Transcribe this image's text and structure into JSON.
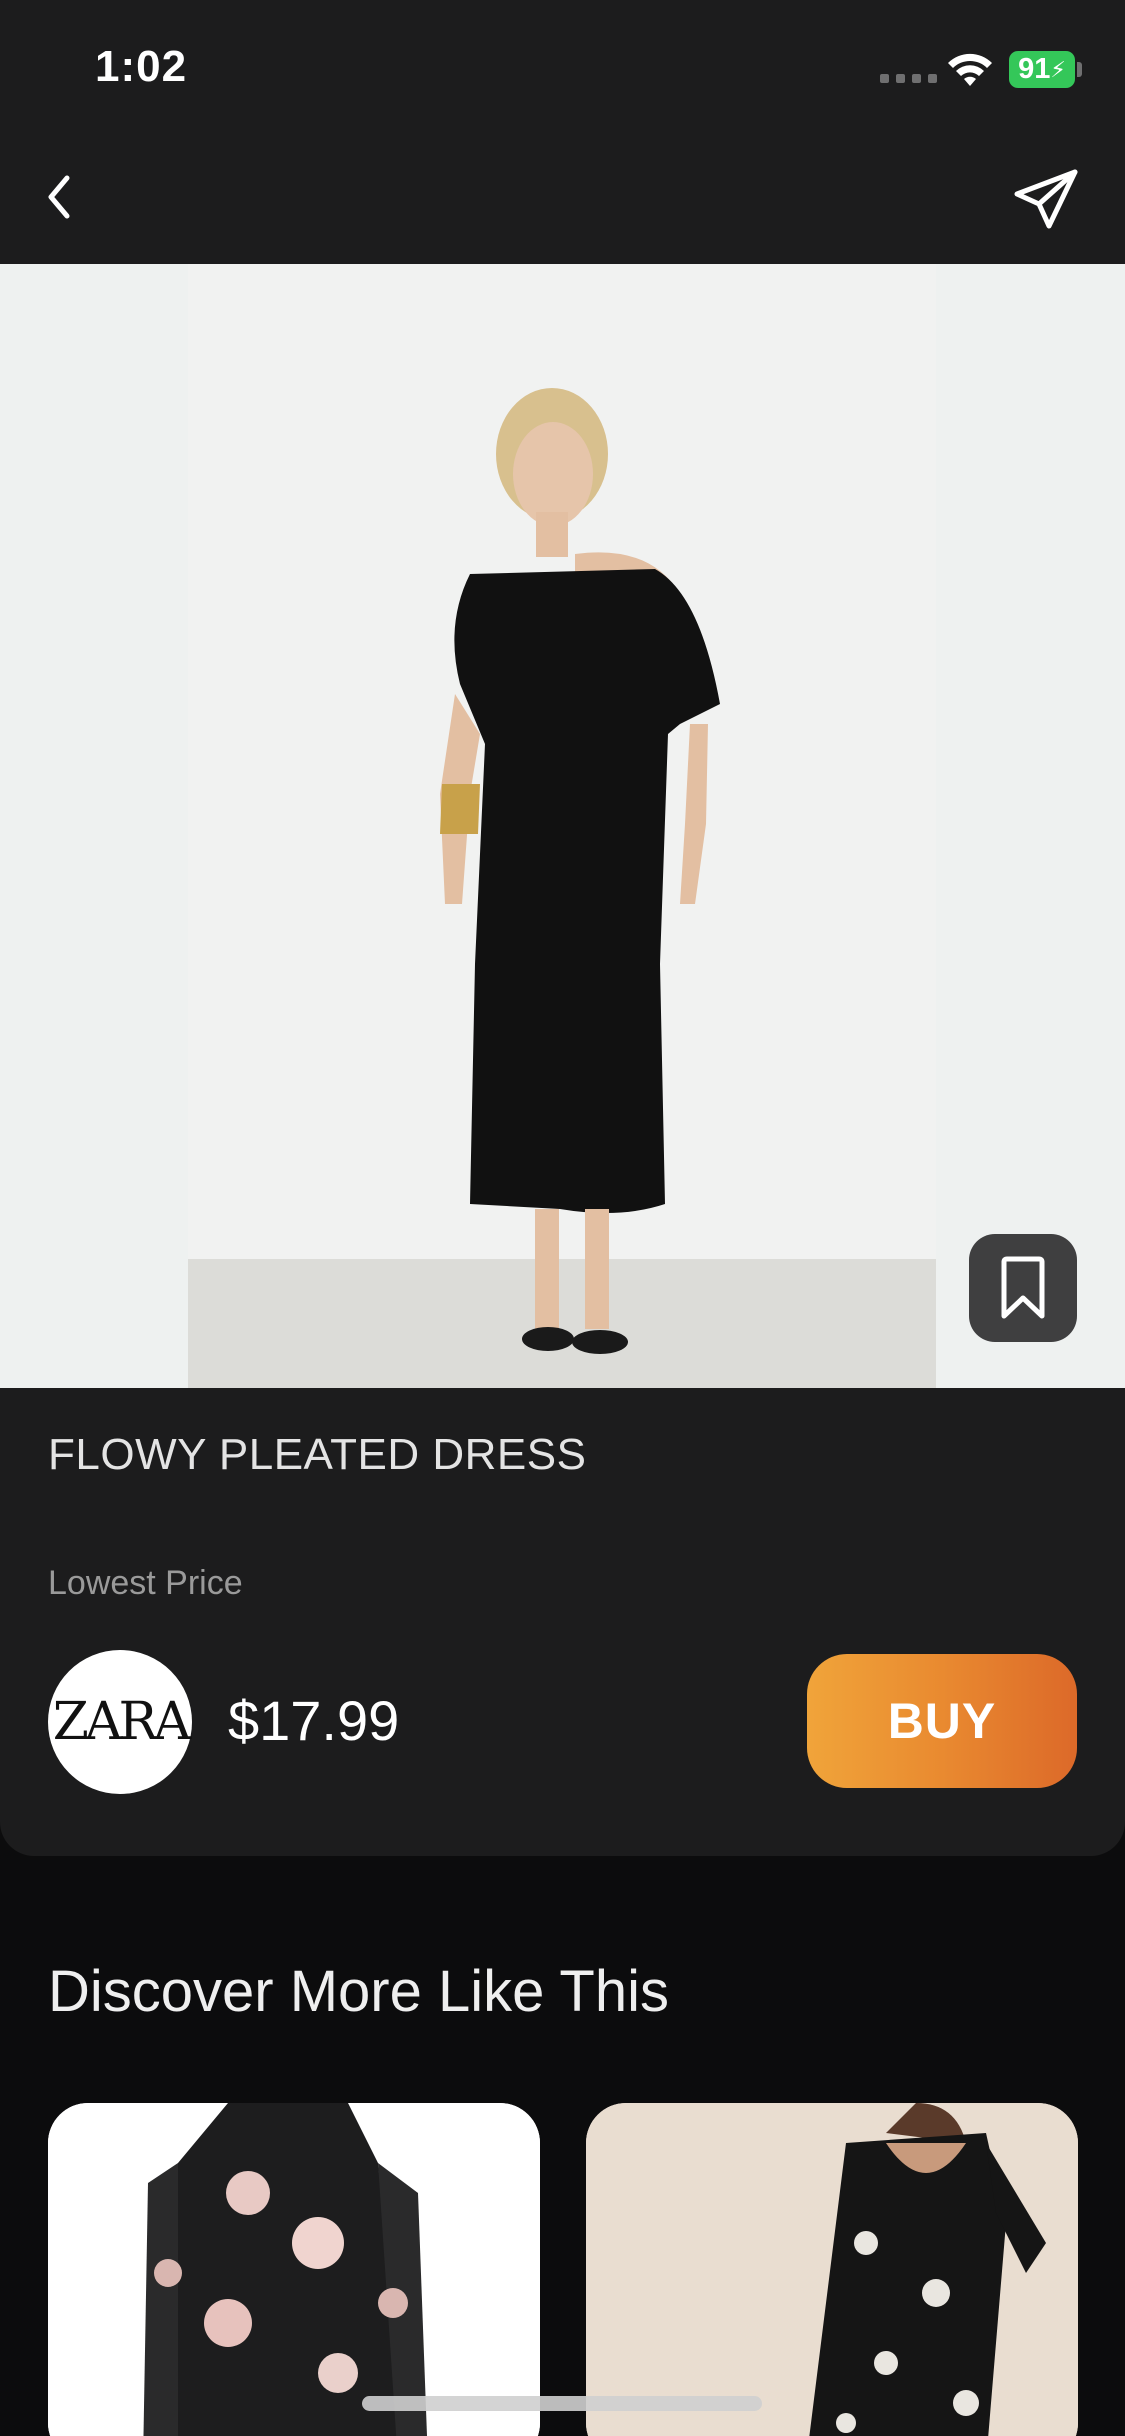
{
  "status_bar": {
    "time": "1:02",
    "battery_level": "91",
    "icons": [
      "cellular-icon",
      "wifi-icon",
      "battery-icon"
    ]
  },
  "nav": {
    "back_icon": "chevron-left-icon",
    "share_icon": "paper-plane-icon"
  },
  "hero": {
    "image_subject": "model in black one-shoulder midi dress",
    "bookmark_icon": "bookmark-icon"
  },
  "product": {
    "title": "FLOWY PLEATED DRESS",
    "price_label": "Lowest Price",
    "brand_logo_text": "ZARA",
    "price": "$17.99",
    "buy_label": "BUY"
  },
  "discover": {
    "title": "Discover More Like This",
    "cards": [
      {
        "image_subject": "black floral print dress"
      },
      {
        "image_subject": "black floral wrap dress"
      }
    ]
  },
  "colors": {
    "background": "#0c0c0d",
    "panel": "#1c1c1d",
    "accent_start": "#f0a43a",
    "accent_end": "#dc6929",
    "battery": "#34c759"
  }
}
